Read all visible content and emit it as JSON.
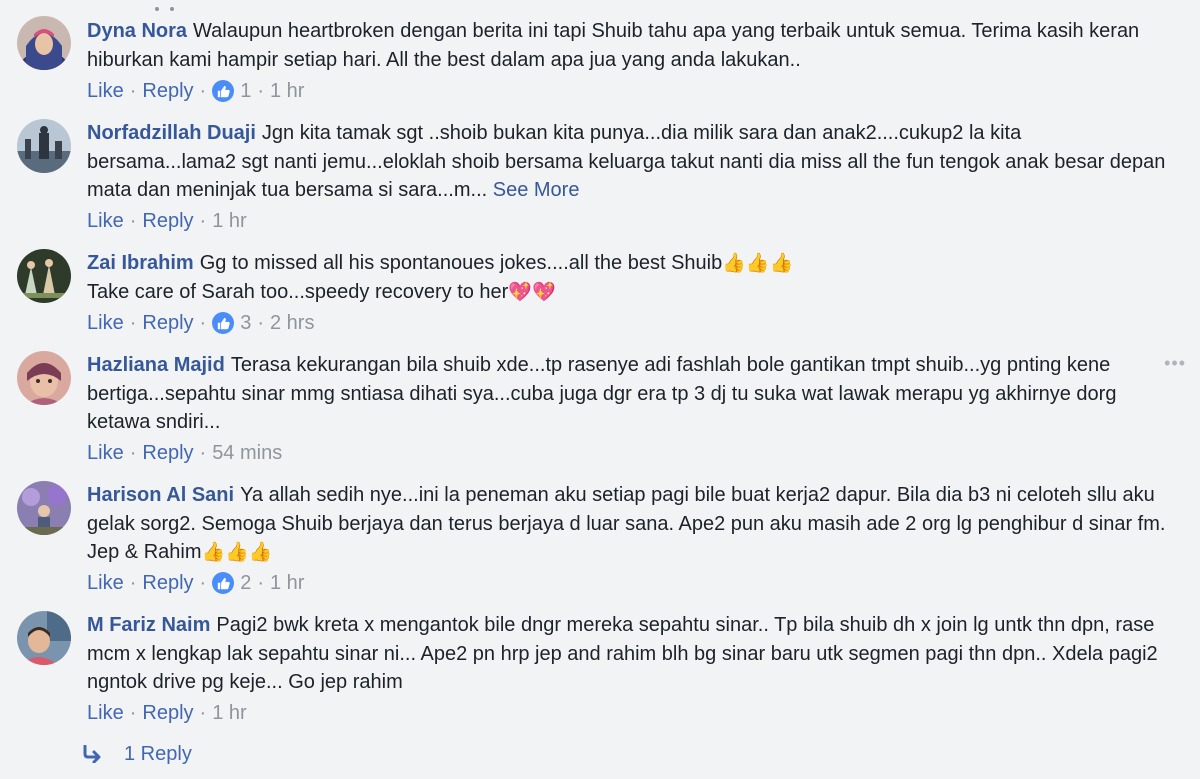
{
  "comments": [
    {
      "name": "Dyna Nora",
      "text": "Walaupun heartbroken dengan berita ini tapi Shuib tahu apa yang terbaik untuk semua. Terima kasih keran hiburkan kami hampir setiap hari. All the best dalam apa jua yang anda lakukan..",
      "like_label": "Like",
      "reply_label": "Reply",
      "reaction_count": "1",
      "time": "1 hr"
    },
    {
      "name": "Norfadzillah Duaji",
      "text": "Jgn kita tamak sgt ..shoib bukan kita punya...dia milik sara dan anak2....cukup2 la kita bersama...lama2 sgt nanti jemu...eloklah shoib bersama keluarga takut nanti dia miss all the fun tengok anak besar depan mata dan meninjak tua bersama si sara...m...",
      "see_more": "See More",
      "like_label": "Like",
      "reply_label": "Reply",
      "time": "1 hr"
    },
    {
      "name": "Zai Ibrahim",
      "text_line1": "Gg to missed all his spontanoues jokes....all the best Shuib",
      "emoji_line1": "👍👍👍",
      "text_line2": "Take care of Sarah too...speedy recovery to her",
      "emoji_line2": "💖💖",
      "like_label": "Like",
      "reply_label": "Reply",
      "reaction_count": "3",
      "time": "2 hrs"
    },
    {
      "name": "Hazliana Majid",
      "text": "Terasa kekurangan bila shuib xde...tp rasenye adi fashlah bole gantikan tmpt shuib...yg pnting kene bertiga...sepahtu sinar mmg sntiasa dihati sya...cuba juga dgr era tp 3 dj tu suka wat lawak merapu yg akhirnye dorg ketawa sndiri...",
      "like_label": "Like",
      "reply_label": "Reply",
      "time": "54 mins",
      "more_icon": "•••"
    },
    {
      "name": "Harison Al Sani",
      "text": "Ya allah sedih nye...ini la peneman aku setiap pagi bile buat kerja2 dapur. Bila dia b3 ni celoteh sllu aku gelak sorg2. Semoga Shuib berjaya dan terus berjaya d luar sana. Ape2 pun aku masih ade 2 org lg penghibur d sinar fm. Jep & Rahim",
      "emoji": "👍👍👍",
      "like_label": "Like",
      "reply_label": "Reply",
      "reaction_count": "2",
      "time": "1 hr"
    },
    {
      "name": "M Fariz Naim",
      "text": "Pagi2 bwk kreta x mengantok bile dngr mereka sepahtu sinar.. Tp bila shuib dh x join lg untk thn dpn, rase mcm x lengkap lak sepahtu sinar ni... Ape2 pn hrp jep and rahim blh bg sinar baru utk segmen pagi thn dpn.. Xdela pagi2 ngntok drive pg keje... Go jep rahim",
      "like_label": "Like",
      "reply_label": "Reply",
      "time": "1 hr"
    }
  ],
  "reply_summary": {
    "label": "1 Reply",
    "icon": "reply-arrow-icon"
  },
  "colors": {
    "background": "#f2f3f5",
    "name": "#365899",
    "link": "#4267b2",
    "meta": "#90949c",
    "text": "#1d2129",
    "like_badge": "#4a8df8"
  }
}
